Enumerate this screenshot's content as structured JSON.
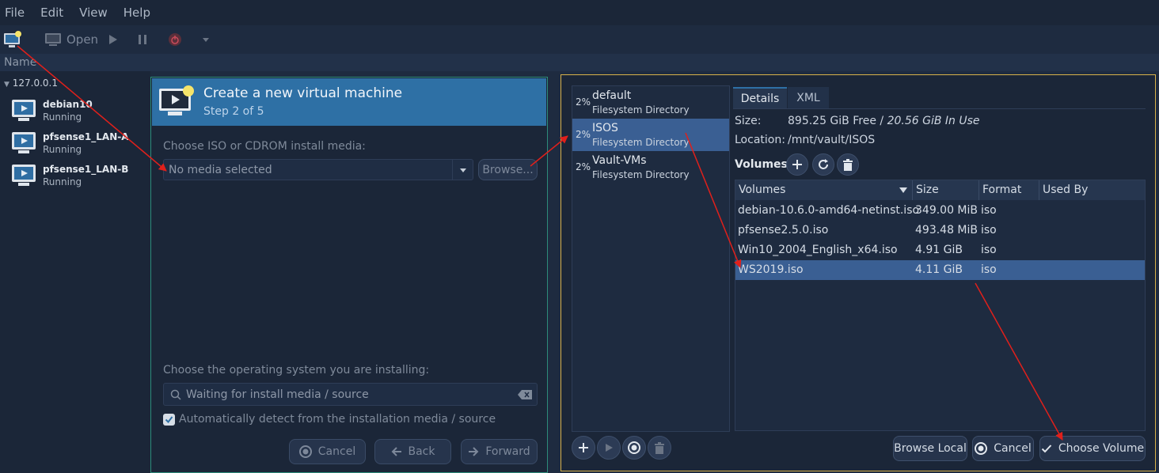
{
  "menu": [
    "File",
    "Edit",
    "View",
    "Help"
  ],
  "toolbar": {
    "open_label": "Open"
  },
  "list_header": "Name",
  "host": "127.0.0.1",
  "vms": [
    {
      "name": "debian10",
      "status": "Running"
    },
    {
      "name": "pfsense1_LAN-A",
      "status": "Running"
    },
    {
      "name": "pfsense1_LAN-B",
      "status": "Running"
    }
  ],
  "wizard": {
    "title": "Create a new virtual machine",
    "step": "Step 2 of 5",
    "media_label": "Choose ISO or CDROM install media:",
    "media_value": "No media selected",
    "browse_label": "Browse...",
    "os_label": "Choose the operating system you are installing:",
    "os_placeholder": "Waiting for install media / source",
    "auto_detect_label": "Automatically detect from the installation media / source",
    "cancel_label": "Cancel",
    "back_label": "Back",
    "forward_label": "Forward"
  },
  "dialog": {
    "pools": [
      {
        "pct": "2%",
        "name": "default",
        "type": "Filesystem Directory"
      },
      {
        "pct": "2%",
        "name": "ISOS",
        "type": "Filesystem Directory"
      },
      {
        "pct": "2%",
        "name": "Vault-VMs",
        "type": "Filesystem Directory"
      }
    ],
    "tabs": [
      "Details",
      "XML"
    ],
    "size_label": "Size:",
    "size_free": "895.25 GiB Free / ",
    "size_used": "20.56 GiB In Use",
    "location_label": "Location:",
    "location_value": "/mnt/vault/ISOS",
    "volumes_label": "Volumes",
    "columns": [
      "Volumes",
      "Size",
      "Format",
      "Used By"
    ],
    "rows": [
      {
        "name": "debian-10.6.0-amd64-netinst.iso",
        "size": "349.00 MiB",
        "format": "iso",
        "used": ""
      },
      {
        "name": "pfsense2.5.0.iso",
        "size": "493.48 MiB",
        "format": "iso",
        "used": ""
      },
      {
        "name": "Win10_2004_English_x64.iso",
        "size": "4.91 GiB",
        "format": "iso",
        "used": ""
      },
      {
        "name": "WS2019.iso",
        "size": "4.11 GiB",
        "format": "iso",
        "used": ""
      }
    ],
    "browse_local_label": "Browse Local",
    "cancel_label": "Cancel",
    "choose_label": "Choose Volume"
  },
  "colors": {
    "accent": "#2e70a5",
    "selection": "#3a5f93",
    "annotation": "#e0201b",
    "dialog_border": "#d9b24a"
  }
}
